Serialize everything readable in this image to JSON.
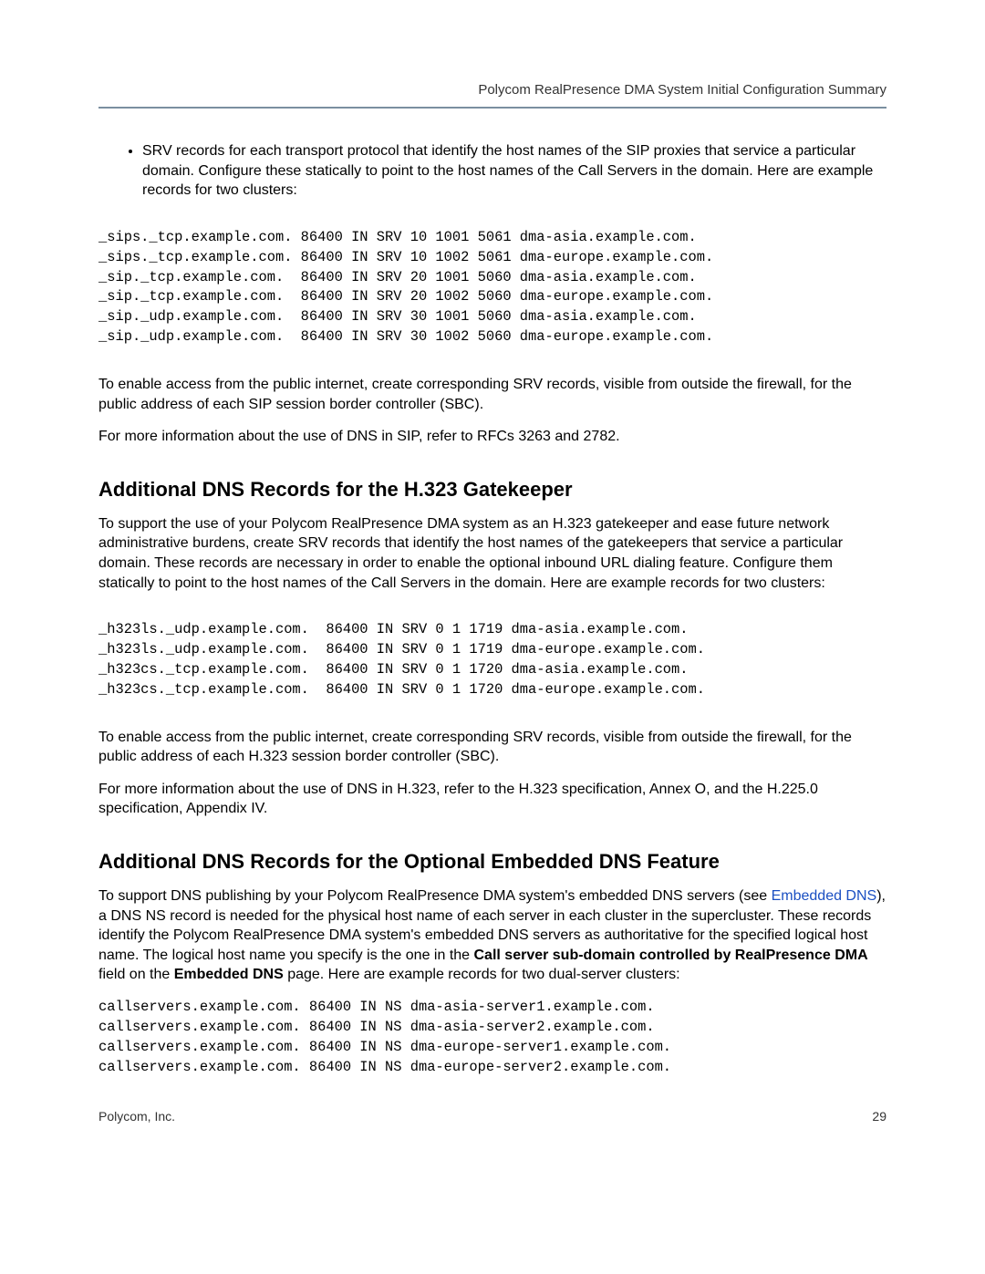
{
  "header": {
    "title": "Polycom RealPresence DMA System Initial Configuration Summary"
  },
  "bullet": {
    "text": "SRV records for each transport protocol that identify the host names of the SIP proxies that service a particular domain. Configure these statically to point to the host names of the Call Servers in the domain. Here are example records for two clusters:"
  },
  "code_sip": "_sips._tcp.example.com. 86400 IN SRV 10 1001 5061 dma-asia.example.com.\n_sips._tcp.example.com. 86400 IN SRV 10 1002 5061 dma-europe.example.com.\n_sip._tcp.example.com.  86400 IN SRV 20 1001 5060 dma-asia.example.com.\n_sip._tcp.example.com.  86400 IN SRV 20 1002 5060 dma-europe.example.com.\n_sip._udp.example.com.  86400 IN SRV 30 1001 5060 dma-asia.example.com.\n_sip._udp.example.com.  86400 IN SRV 30 1002 5060 dma-europe.example.com.",
  "para_sip_access": "To enable access from the public internet, create corresponding SRV records, visible from outside the firewall, for the public address of each SIP session border controller (SBC).",
  "para_sip_rfc": "For more information about the use of DNS in SIP, refer to RFCs 3263 and 2782.",
  "heading_h323": "Additional DNS Records for the H.323 Gatekeeper",
  "para_h323_intro": "To support the use of your Polycom RealPresence DMA system as an H.323 gatekeeper and ease future network administrative burdens, create SRV records that identify the host names of the gatekeepers that service a particular domain. These records are necessary in order to enable the optional inbound URL dialing feature. Configure them statically to point to the host names of the Call Servers in the domain. Here are example records for two clusters:",
  "code_h323": "_h323ls._udp.example.com.  86400 IN SRV 0 1 1719 dma-asia.example.com.\n_h323ls._udp.example.com.  86400 IN SRV 0 1 1719 dma-europe.example.com.\n_h323cs._tcp.example.com.  86400 IN SRV 0 1 1720 dma-asia.example.com.\n_h323cs._tcp.example.com.  86400 IN SRV 0 1 1720 dma-europe.example.com.",
  "para_h323_access": "To enable access from the public internet, create corresponding SRV records, visible from outside the firewall, for the public address of each H.323 session border controller (SBC).",
  "para_h323_spec": "For more information about the use of DNS in H.323, refer to the H.323 specification, Annex O, and the H.225.0 specification, Appendix IV.",
  "heading_embedded": "Additional DNS Records for the Optional Embedded DNS Feature",
  "embedded": {
    "pre_link": "To support DNS publishing by your Polycom RealPresence DMA system's embedded DNS servers (see ",
    "link_text": "Embedded DNS",
    "post_link_1": "), a DNS NS record is needed for the physical host name of each server in each cluster in the supercluster. These records identify the Polycom RealPresence DMA system's embedded DNS servers as authoritative for the specified logical host name. The logical host name you specify is the one in the ",
    "bold_1": "Call server sub-domain controlled by RealPresence DMA",
    "mid_text": " field on the ",
    "bold_2": "Embedded DNS",
    "post_2": " page. Here are example records for two dual-server clusters:"
  },
  "code_ns": "callservers.example.com. 86400 IN NS dma-asia-server1.example.com.\ncallservers.example.com. 86400 IN NS dma-asia-server2.example.com.\ncallservers.example.com. 86400 IN NS dma-europe-server1.example.com.\ncallservers.example.com. 86400 IN NS dma-europe-server2.example.com.",
  "footer": {
    "left": "Polycom, Inc.",
    "right": "29"
  }
}
